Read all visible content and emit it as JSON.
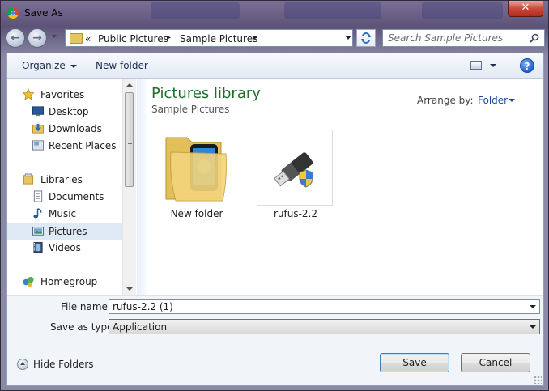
{
  "window": {
    "title": "Save As",
    "close_label": "✕"
  },
  "address": {
    "overflow": "«",
    "crumbs": [
      "Public Pictures",
      "Sample Pictures"
    ],
    "separator": "▸"
  },
  "search": {
    "placeholder": "Search Sample Pictures"
  },
  "toolbar": {
    "organize": "Organize",
    "new_folder": "New folder",
    "help": "?"
  },
  "nav": {
    "groups": [
      {
        "label": "Favorites",
        "icon": "star-icon"
      },
      {
        "label": "Desktop",
        "icon": "desktop-icon"
      },
      {
        "label": "Downloads",
        "icon": "downloads-icon"
      },
      {
        "label": "Recent Places",
        "icon": "recent-places-icon"
      },
      {
        "label": "Libraries",
        "icon": "libraries-icon"
      },
      {
        "label": "Documents",
        "icon": "documents-icon"
      },
      {
        "label": "Music",
        "icon": "music-icon"
      },
      {
        "label": "Pictures",
        "icon": "pictures-icon",
        "selected": true
      },
      {
        "label": "Videos",
        "icon": "videos-icon"
      },
      {
        "label": "Homegroup",
        "icon": "homegroup-icon"
      }
    ]
  },
  "content": {
    "library_title": "Pictures library",
    "library_subtitle": "Sample Pictures",
    "arrange_label": "Arrange by:",
    "arrange_value": "Folder",
    "files": [
      {
        "name": "New folder",
        "icon": "folder-icon"
      },
      {
        "name": "rufus-2.2",
        "icon": "usb-drive-shield-icon"
      }
    ]
  },
  "form": {
    "file_name_label": "File name:",
    "file_name_value": "rufus-2.2 (1)",
    "save_type_label": "Save as type:",
    "save_type_value": "Application"
  },
  "footer": {
    "hide_folders": "Hide Folders",
    "save": "Save",
    "cancel": "Cancel"
  },
  "colors": {
    "library_title": "#1e6e2a",
    "selection": "#dfe8f5",
    "accent": "#1e4ca0"
  }
}
